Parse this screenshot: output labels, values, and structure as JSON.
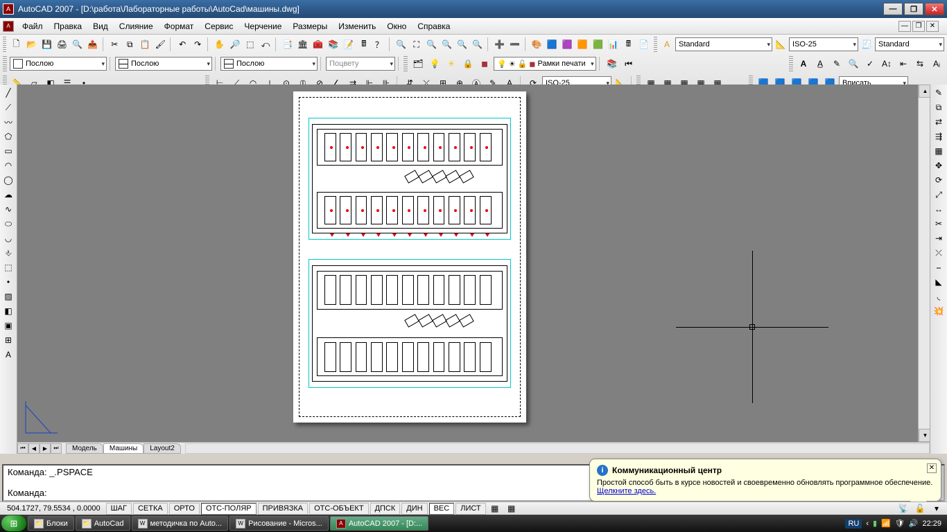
{
  "title": "AutoCAD 2007 - [D:\\работа\\Лабораторные работы\\AutoCad\\машины.dwg]",
  "menu": {
    "file": "Файл",
    "edit": "Правка",
    "view": "Вид",
    "merge": "Слияние",
    "format": "Формат",
    "service": "Сервис",
    "draw": "Черчение",
    "dim": "Размеры",
    "mod": "Изменить",
    "win": "Окно",
    "help": "Справка"
  },
  "combos": {
    "layer": "Послою",
    "layer2": "Послою",
    "layer3": "Послою",
    "bycolor": "Поцвету",
    "style1": "Standard",
    "dimstyle": "ISO-25",
    "style2": "Standard",
    "dimstyle2": "ISO-25",
    "fit": "Вписать",
    "frames": "Рамки печати"
  },
  "tabs": {
    "model": "Модель",
    "t1": "Машины",
    "t2": "Layout2"
  },
  "cmd": {
    "l1": "Команда: _.PSPACE",
    "l2": "Команда: "
  },
  "status": {
    "coords": "504.1727, 79.5534 , 0.0000",
    "snap": "ШАГ",
    "grid": "СЕТКА",
    "ortho": "ОРТО",
    "polar": "ОТС-ПОЛЯР",
    "osnap": "ПРИВЯЗКА",
    "otrack": "ОТС-ОБЪЕКТ",
    "dyn": "ДПСК",
    "dynin": "ДИН",
    "lwt": "ВЕС",
    "modelbtn": "ЛИСТ"
  },
  "popup": {
    "title": "Коммуникационный центр",
    "body": "Простой способ быть в курсе новостей и своевременно обновлять программное обеспечение.",
    "link": "Щелкните здесь."
  },
  "taskbar": {
    "t1": "Блоки",
    "t2": "AutoCad",
    "t3": "методичка по Auto...",
    "t4": "Рисование - Micros...",
    "t5": "AutoCAD 2007 - [D:...",
    "lang": "RU",
    "clock": "22:29"
  }
}
